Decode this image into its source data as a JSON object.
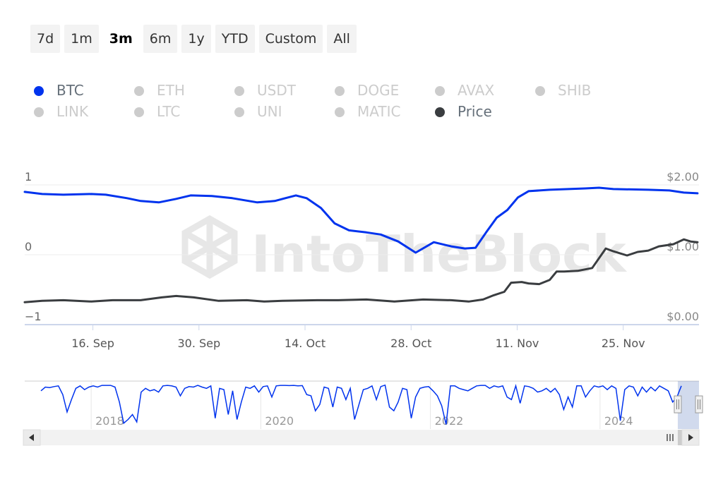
{
  "range_selector": {
    "buttons": [
      "7d",
      "1m",
      "3m",
      "6m",
      "1y",
      "YTD",
      "Custom",
      "All"
    ],
    "active": "3m"
  },
  "legend": {
    "items": [
      {
        "label": "BTC",
        "color": "#0033ee",
        "active": true
      },
      {
        "label": "ETH",
        "color": "#cccccc",
        "active": false
      },
      {
        "label": "USDT",
        "color": "#cccccc",
        "active": false
      },
      {
        "label": "DOGE",
        "color": "#cccccc",
        "active": false
      },
      {
        "label": "AVAX",
        "color": "#cccccc",
        "active": false
      },
      {
        "label": "SHIB",
        "color": "#cccccc",
        "active": false
      },
      {
        "label": "LINK",
        "color": "#cccccc",
        "active": false
      },
      {
        "label": "LTC",
        "color": "#cccccc",
        "active": false
      },
      {
        "label": "UNI",
        "color": "#cccccc",
        "active": false
      },
      {
        "label": "MATIC",
        "color": "#cccccc",
        "active": false
      },
      {
        "label": "Price",
        "color": "#3a3d40",
        "active": true
      }
    ]
  },
  "watermark": "IntoTheBlock",
  "chart_data": {
    "type": "line",
    "title": "",
    "x_unit": "days since 7 Sep",
    "x_range": [
      0,
      89
    ],
    "x_ticks": [
      {
        "day": 9,
        "label": "16. Sep"
      },
      {
        "day": 23,
        "label": "30. Sep"
      },
      {
        "day": 37,
        "label": "14. Oct"
      },
      {
        "day": 51,
        "label": "28. Oct"
      },
      {
        "day": 65,
        "label": "11. Nov"
      },
      {
        "day": 79,
        "label": "25. Nov"
      }
    ],
    "y_left": {
      "range": [
        -1,
        1
      ],
      "ticks": [
        {
          "value": 1,
          "label": "1"
        },
        {
          "value": 0,
          "label": "0"
        },
        {
          "value": -1,
          "label": "−1"
        }
      ]
    },
    "y_right": {
      "range": [
        0,
        2
      ],
      "ticks": [
        {
          "value": 2,
          "label": "$2.00"
        },
        {
          "value": 1,
          "label": "$1.00"
        },
        {
          "value": 0,
          "label": "$0.00"
        }
      ]
    },
    "grid": true,
    "legend_position": "top-left",
    "series": [
      {
        "name": "BTC",
        "axis": "left",
        "color": "#0033ee",
        "x": [
          0,
          2.3,
          5.1,
          8.8,
          10.7,
          13.5,
          15.3,
          17.7,
          20,
          21.9,
          24.7,
          27.4,
          30.7,
          33,
          34.4,
          35.8,
          37.2,
          39.1,
          40.9,
          42.8,
          45.1,
          47,
          49.3,
          51.6,
          54,
          56.3,
          58.1,
          59.5,
          60.9,
          62.3,
          63.7,
          65.1,
          66.5,
          69.3,
          74,
          75.8,
          77.7,
          82.3,
          85.1,
          87,
          88.8
        ],
        "y": [
          0.9,
          0.87,
          0.86,
          0.87,
          0.86,
          0.81,
          0.77,
          0.75,
          0.8,
          0.85,
          0.84,
          0.81,
          0.75,
          0.77,
          0.81,
          0.85,
          0.81,
          0.67,
          0.45,
          0.35,
          0.32,
          0.29,
          0.19,
          0.03,
          0.18,
          0.12,
          0.09,
          0.1,
          0.32,
          0.53,
          0.64,
          0.82,
          0.91,
          0.93,
          0.95,
          0.96,
          0.94,
          0.93,
          0.92,
          0.89,
          0.88
        ]
      },
      {
        "name": "Price",
        "axis": "right",
        "color": "#3a3d40",
        "x": [
          0,
          2.3,
          5.1,
          8.8,
          11.6,
          15.3,
          18.1,
          20,
          22.3,
          25.6,
          29.3,
          31.6,
          34,
          38.6,
          41.4,
          45.1,
          48.8,
          52.6,
          56.3,
          58.6,
          60.5,
          61.9,
          63.3,
          64.2,
          65.6,
          66.5,
          67.9,
          69.3,
          70.2,
          71.2,
          73,
          74.9,
          76.7,
          77.7,
          79.5,
          80.9,
          82.3,
          83.7,
          85.6,
          87,
          87.9,
          88.8
        ],
        "y": [
          0.32,
          0.34,
          0.35,
          0.33,
          0.35,
          0.35,
          0.39,
          0.41,
          0.39,
          0.34,
          0.35,
          0.33,
          0.34,
          0.35,
          0.35,
          0.36,
          0.33,
          0.36,
          0.35,
          0.33,
          0.36,
          0.42,
          0.47,
          0.6,
          0.61,
          0.59,
          0.58,
          0.64,
          0.76,
          0.76,
          0.77,
          0.81,
          1.09,
          1.05,
          0.99,
          1.04,
          1.06,
          1.12,
          1.15,
          1.22,
          1.19,
          1.18
        ]
      }
    ],
    "navigator": {
      "series_name": "BTC",
      "x_range": [
        2017.0,
        2024.95
      ],
      "x_ticks": [
        {
          "value": 2018,
          "label": "2018"
        },
        {
          "value": 2020,
          "label": "2020"
        },
        {
          "value": 2022,
          "label": "2022"
        },
        {
          "value": 2024,
          "label": "2024"
        }
      ],
      "selected_range": [
        2024.7,
        2024.95
      ],
      "y": [
        0.75,
        0.9,
        0.88,
        0.92,
        0.95,
        0.6,
        -0.1,
        0.4,
        0.85,
        0.95,
        0.8,
        0.9,
        0.95,
        0.9,
        0.97,
        0.97,
        0.97,
        0.9,
        0.3,
        -0.55,
        -0.4,
        -0.2,
        -0.5,
        0.7,
        0.85,
        0.75,
        0.8,
        0.7,
        0.95,
        0.97,
        0.95,
        0.9,
        0.55,
        0.85,
        0.92,
        0.9,
        0.97,
        0.9,
        0.85,
        0.95,
        -0.35,
        0.85,
        0.8,
        -0.2,
        0.75,
        -0.4,
        0.3,
        0.9,
        0.85,
        0.95,
        0.7,
        0.92,
        0.95,
        0.5,
        0.95,
        0.97,
        0.97,
        0.96,
        0.97,
        0.95,
        0.96,
        0.6,
        0.55,
        -0.05,
        0.2,
        0.9,
        0.85,
        0.1,
        0.9,
        0.85,
        0.4,
        0.85,
        -0.4,
        0.2,
        0.8,
        0.85,
        0.95,
        0.4,
        0.92,
        0.98,
        0.1,
        -0.05,
        0.3,
        0.85,
        0.8,
        -0.35,
        0.5,
        0.85,
        0.9,
        0.92,
        0.75,
        0.55,
        0.15,
        -0.6,
        0.95,
        0.95,
        0.85,
        0.8,
        0.75,
        0.85,
        0.95,
        0.97,
        0.97,
        0.85,
        0.95,
        0.9,
        0.95,
        0.5,
        0.4,
        0.95,
        0.25,
        0.95,
        0.92,
        0.85,
        0.7,
        0.75,
        0.85,
        0.7,
        0.85,
        0.6,
        0.0,
        0.5,
        0.1,
        0.95,
        0.95,
        0.5,
        0.75,
        0.95,
        0.9,
        0.95,
        0.8,
        0.95,
        0.85,
        -0.45,
        0.8,
        0.95,
        0.9,
        0.55,
        0.9,
        0.7,
        0.9,
        0.75,
        0.95,
        0.85,
        0.75,
        0.3,
        0.5,
        0.95
      ]
    }
  }
}
